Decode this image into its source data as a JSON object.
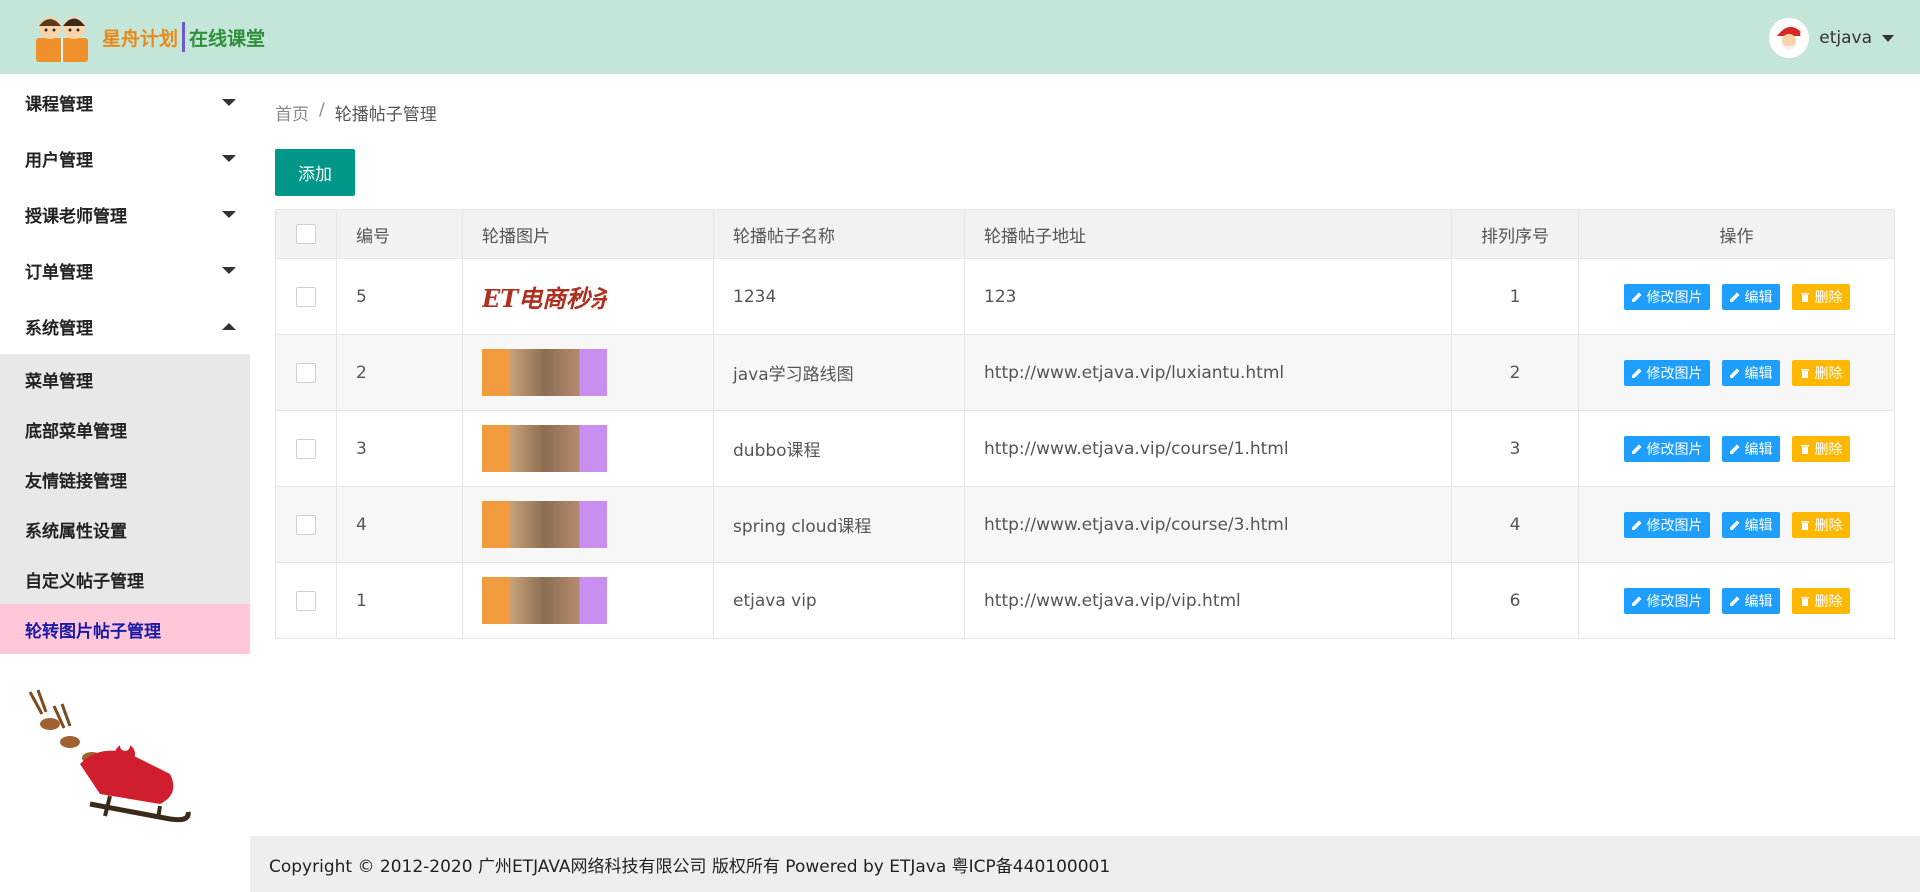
{
  "brand": {
    "title_part1": "星舟计划",
    "title_part2": "在线课堂"
  },
  "user": {
    "name": "etjava"
  },
  "sidebar": {
    "menus": [
      {
        "label": "课程管理",
        "expanded": false
      },
      {
        "label": "用户管理",
        "expanded": false
      },
      {
        "label": "授课老师管理",
        "expanded": false
      },
      {
        "label": "订单管理",
        "expanded": false
      },
      {
        "label": "系统管理",
        "expanded": true
      }
    ],
    "submenu": [
      {
        "label": "菜单管理"
      },
      {
        "label": "底部菜单管理"
      },
      {
        "label": "友情链接管理"
      },
      {
        "label": "系统属性设置"
      },
      {
        "label": "自定义帖子管理"
      },
      {
        "label": "轮转图片帖子管理",
        "active": true
      }
    ]
  },
  "breadcrumb": {
    "home": "首页",
    "separator": "/",
    "current": "轮播帖子管理"
  },
  "toolbar": {
    "add_label": "添加"
  },
  "table": {
    "headers": {
      "id": "编号",
      "image": "轮播图片",
      "name": "轮播帖子名称",
      "url": "轮播帖子地址",
      "sort": "排列序号",
      "ops": "操作"
    },
    "logo_image_text": "ET电商秒杀",
    "actions": {
      "edit_image": "修改图片",
      "edit": "编辑",
      "delete": "删除"
    },
    "rows": [
      {
        "id": "5",
        "name": "1234",
        "url": "123",
        "sort": "1"
      },
      {
        "id": "2",
        "name": "java学习路线图",
        "url": "http://www.etjava.vip/luxiantu.html",
        "sort": "2"
      },
      {
        "id": "3",
        "name": "dubbo课程",
        "url": "http://www.etjava.vip/course/1.html",
        "sort": "3"
      },
      {
        "id": "4",
        "name": "spring cloud课程",
        "url": "http://www.etjava.vip/course/3.html",
        "sort": "4"
      },
      {
        "id": "1",
        "name": "etjava vip",
        "url": "http://www.etjava.vip/vip.html",
        "sort": "6"
      }
    ]
  },
  "footer": {
    "text": "Copyright © 2012-2020 广州ETJAVA网络科技有限公司 版权所有 Powered by ETJava 粤ICP备440100001"
  },
  "colors": {
    "header_bg": "#c3e6d8",
    "add_button": "#009688",
    "action_blue": "#1e9fff",
    "action_orange": "#ffb800",
    "active_menu": "#ffc7d8"
  }
}
